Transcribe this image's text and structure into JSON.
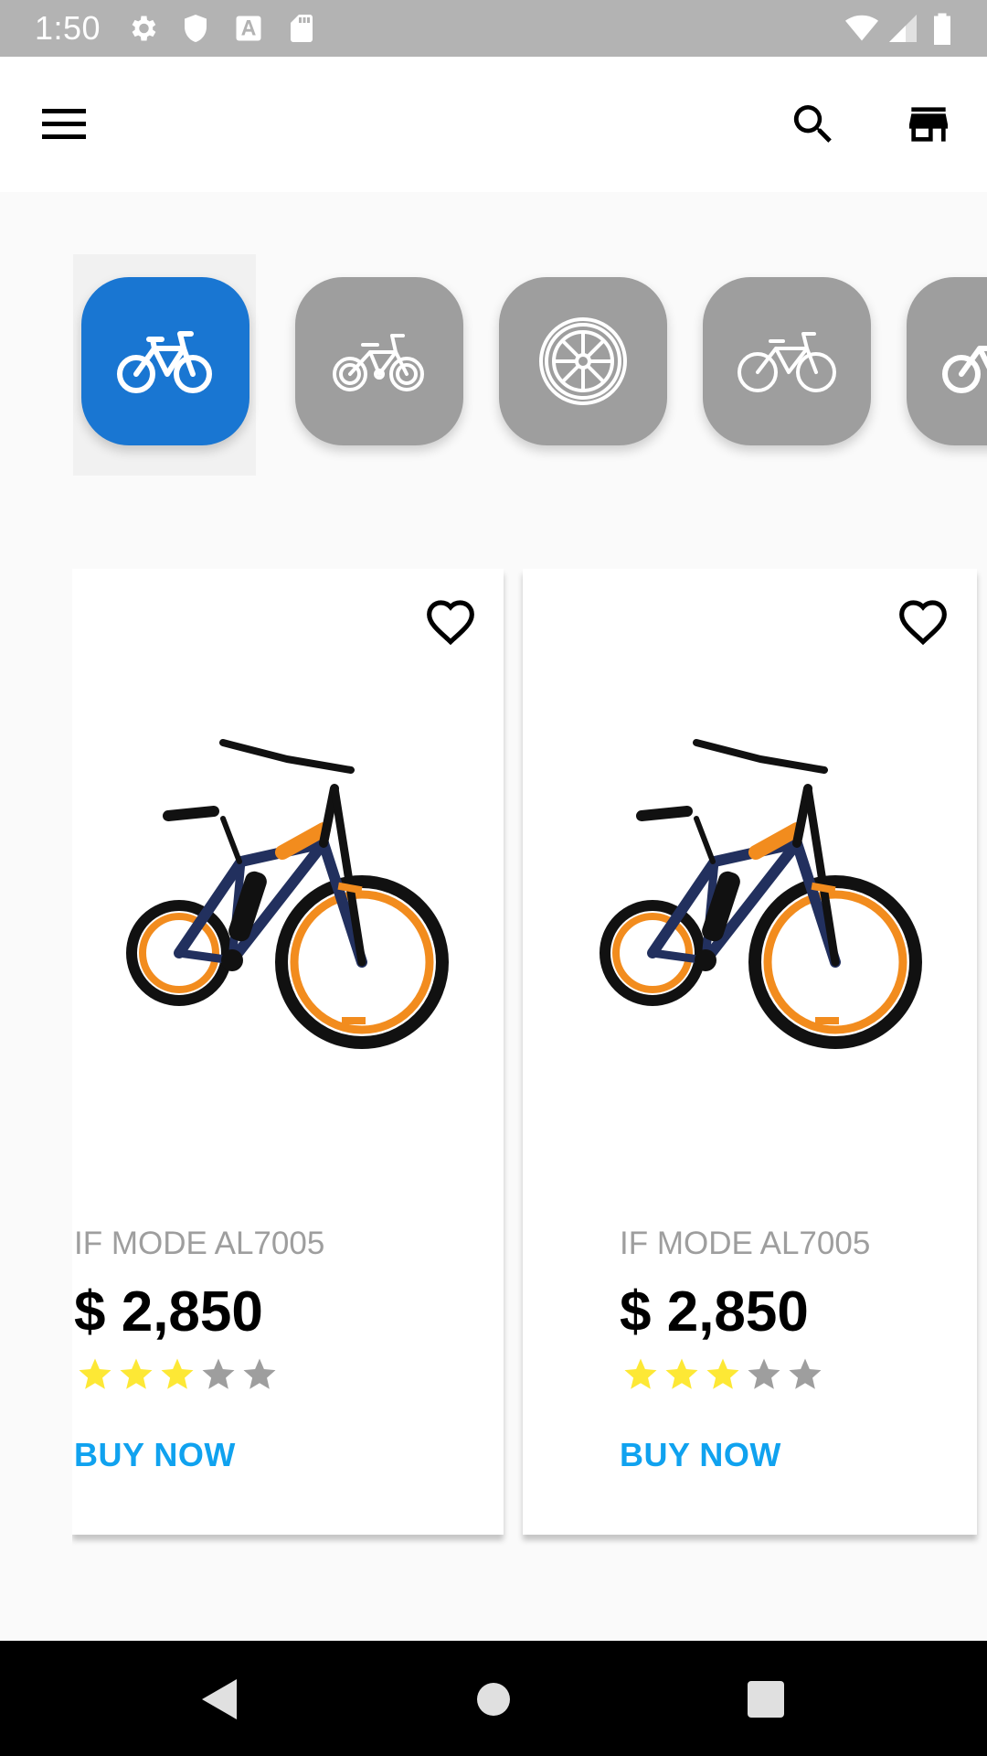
{
  "status_bar": {
    "time": "1:50",
    "icons": [
      "gear-icon",
      "shield-icon",
      "font-a-icon",
      "sd-card-icon",
      "wifi-icon",
      "signal-icon",
      "battery-icon"
    ]
  },
  "app_bar": {
    "icons": [
      "menu-icon",
      "search-icon",
      "storefront-icon"
    ]
  },
  "categories": [
    {
      "icon": "bicycle-icon",
      "selected": true
    },
    {
      "icon": "kids-bicycle-icon",
      "selected": false
    },
    {
      "icon": "wheel-icon",
      "selected": false
    },
    {
      "icon": "road-bicycle-icon",
      "selected": false
    },
    {
      "icon": "bicycle-icon",
      "selected": false
    }
  ],
  "colors": {
    "category_selected": "#1976d2",
    "category_default": "#9e9e9e",
    "buy_now": "#10a2ef",
    "star_filled": "#fde835",
    "star_empty": "#9e9e9e"
  },
  "products": [
    {
      "name": "IF MODE AL7005",
      "price": "$ 2,850",
      "rating": 3,
      "rating_max": 5,
      "buy_label": "BUY NOW",
      "favorite_icon": "heart-outline-icon"
    },
    {
      "name": "IF MODE AL7005",
      "price": "$ 2,850",
      "rating": 3,
      "rating_max": 5,
      "buy_label": "BUY NOW",
      "favorite_icon": "heart-outline-icon"
    }
  ],
  "nav_bar": {
    "icons": [
      "back-icon",
      "home-icon",
      "recents-icon"
    ]
  }
}
